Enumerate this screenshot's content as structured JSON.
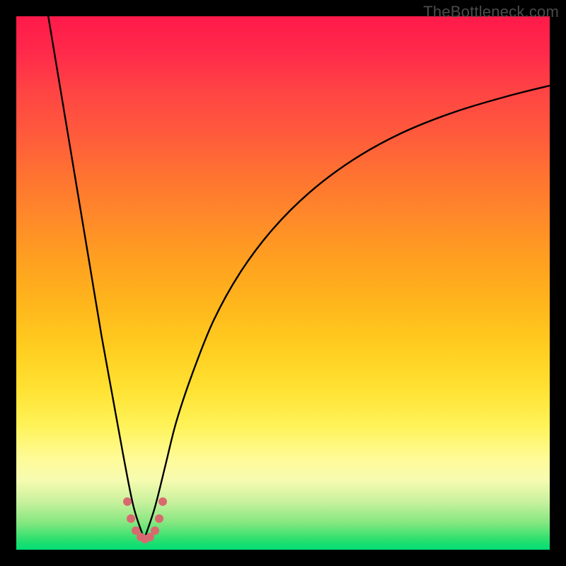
{
  "watermark": "TheBottleneck.com",
  "colors": {
    "background": "#000000",
    "curve": "#000000",
    "beads": "#d86a6f",
    "gradient_top": "#ff1a4a",
    "gradient_bottom": "#00dd75"
  },
  "chart_data": {
    "type": "line",
    "title": "",
    "xlabel": "",
    "ylabel": "",
    "xlim": [
      0,
      100
    ],
    "ylim": [
      0,
      100
    ],
    "note": "No axes, ticks, or legend are visible. Values are estimated from pixel positions on a 0-100 normalized scale. Two curves descend to a shared minimum near x≈24, y≈2; left curve rises steeply toward top-left, right curve rises more gradually toward upper-right. A cluster of salmon dots sits at the valley.",
    "series": [
      {
        "name": "left-curve",
        "x": [
          6,
          8,
          10,
          12,
          14,
          16,
          18,
          20,
          22,
          24
        ],
        "y": [
          100,
          88,
          76,
          64,
          52,
          40,
          29,
          18,
          8,
          2
        ]
      },
      {
        "name": "right-curve",
        "x": [
          24,
          26,
          28,
          30,
          33,
          37,
          42,
          48,
          55,
          63,
          72,
          82,
          92,
          100
        ],
        "y": [
          2,
          8,
          16,
          24,
          33,
          43,
          52,
          60,
          67,
          73,
          78,
          82,
          85,
          87
        ]
      }
    ],
    "beads": {
      "name": "valley-dots",
      "x": [
        20.8,
        21.5,
        22.4,
        23.3,
        24.2,
        25.1,
        26.0,
        26.8,
        27.5
      ],
      "y": [
        9.0,
        5.8,
        3.6,
        2.4,
        2.0,
        2.4,
        3.6,
        5.8,
        9.0
      ]
    }
  }
}
